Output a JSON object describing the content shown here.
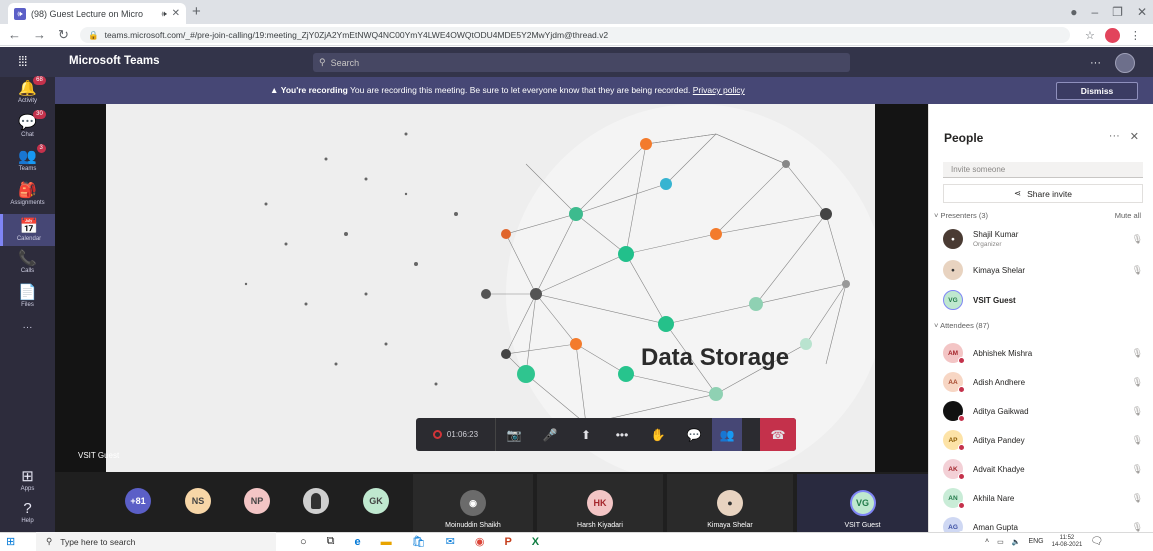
{
  "browser": {
    "tab_title": "(98) Guest Lecture on Micro",
    "tab_favicon": "teams-icon",
    "tab_glyph": "🕪",
    "url": "teams.microsoft.com/_#/pre-join-calling/19:meeting_ZjY0ZjA2YmEtNWQ4NC00YmY4LWE4OWQtODU4MDE5Y2MwYjdm@thread.v2"
  },
  "teams": {
    "brand": "Microsoft Teams",
    "search_placeholder": "Search",
    "more_menu": "···"
  },
  "rail": [
    {
      "label": "Activity",
      "icon": "bell-icon",
      "glyph": "🔔",
      "badge": "68"
    },
    {
      "label": "Chat",
      "icon": "chat-icon",
      "glyph": "💬",
      "badge": "30"
    },
    {
      "label": "Teams",
      "icon": "teams-icon",
      "glyph": "👥",
      "badge": "3"
    },
    {
      "label": "Assignments",
      "icon": "assignments-icon",
      "glyph": "🎒",
      "badge": ""
    },
    {
      "label": "Calendar",
      "icon": "calendar-icon",
      "glyph": "📅",
      "badge": ""
    },
    {
      "label": "Calls",
      "icon": "phone-icon",
      "glyph": "📞",
      "badge": ""
    },
    {
      "label": "Files",
      "icon": "file-icon",
      "glyph": "📄",
      "badge": ""
    },
    {
      "label": "···",
      "icon": "more-icon",
      "glyph": "",
      "badge": ""
    },
    {
      "label": "Apps",
      "icon": "apps-icon",
      "glyph": "⊞",
      "badge": ""
    },
    {
      "label": "Help",
      "icon": "help-icon",
      "glyph": "?",
      "badge": ""
    }
  ],
  "banner": {
    "bold": "You're recording",
    "text": " You are recording this meeting. Be sure to let everyone know that they are being recorded. ",
    "link": "Privacy policy",
    "dismiss": "Dismiss"
  },
  "slide": {
    "title": "Data Storage"
  },
  "stage": {
    "presenter_tag": "VSIT Guest"
  },
  "controls": {
    "timer": "01:06:23",
    "recording_color": "#d13438",
    "leave_color": "#c4314b"
  },
  "strip": {
    "overflow": "+81",
    "avatars": [
      "NS",
      "NP",
      "",
      "GK"
    ],
    "tiles": [
      {
        "name": "Moinuddin Shaikh",
        "initials": ""
      },
      {
        "name": "Harsh Kiyadari",
        "initials": "HK"
      },
      {
        "name": "Kimaya Shelar",
        "initials": ""
      },
      {
        "name": "VSIT Guest",
        "initials": "VG"
      }
    ]
  },
  "people": {
    "title": "People",
    "invite_placeholder": "Invite someone",
    "share_invite": "Share invite",
    "presenters_header": "Presenters (3)",
    "mute_all": "Mute all",
    "presenters": [
      {
        "name": "Shajil Kumar",
        "sub": "Organizer",
        "initials": ""
      },
      {
        "name": "Kimaya Shelar",
        "sub": "",
        "initials": ""
      },
      {
        "name": "VSIT Guest",
        "sub": "",
        "initials": "VG"
      }
    ],
    "attendees_header": "Attendees (87)",
    "attendees": [
      {
        "name": "Abhishek Mishra",
        "initials": "AM"
      },
      {
        "name": "Adish Andhere",
        "initials": "AA"
      },
      {
        "name": "Aditya Gaikwad",
        "initials": ""
      },
      {
        "name": "Aditya Pandey",
        "initials": "AP"
      },
      {
        "name": "Advait Khadye",
        "initials": "AK"
      },
      {
        "name": "Akhila Nare",
        "initials": "AN"
      },
      {
        "name": "Aman Gupta",
        "initials": "AG"
      }
    ]
  },
  "taskbar": {
    "search_placeholder": "Type here to search",
    "lang": "ENG",
    "time": "11:52",
    "date": "14-08-2021"
  },
  "colors": {
    "teams_purple": "#464775",
    "header": "#33344a",
    "rail": "#2d2c3c",
    "accent": "#7f85f5"
  }
}
